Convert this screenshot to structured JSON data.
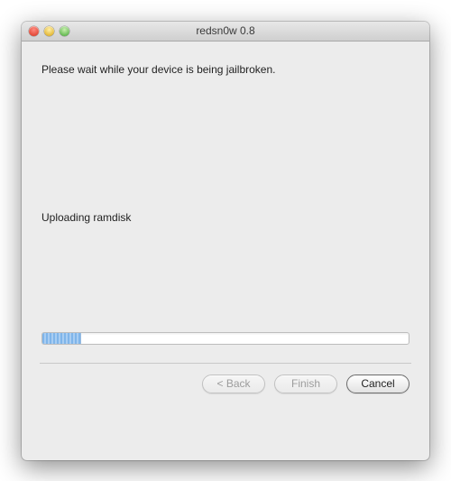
{
  "window": {
    "title": "redsn0w 0.8"
  },
  "content": {
    "main_message": "Please wait while your device is being jailbroken.",
    "status_message": "Uploading ramdisk",
    "progress_percent": 10.5
  },
  "buttons": {
    "back_label": "< Back",
    "finish_label": "Finish",
    "cancel_label": "Cancel"
  }
}
